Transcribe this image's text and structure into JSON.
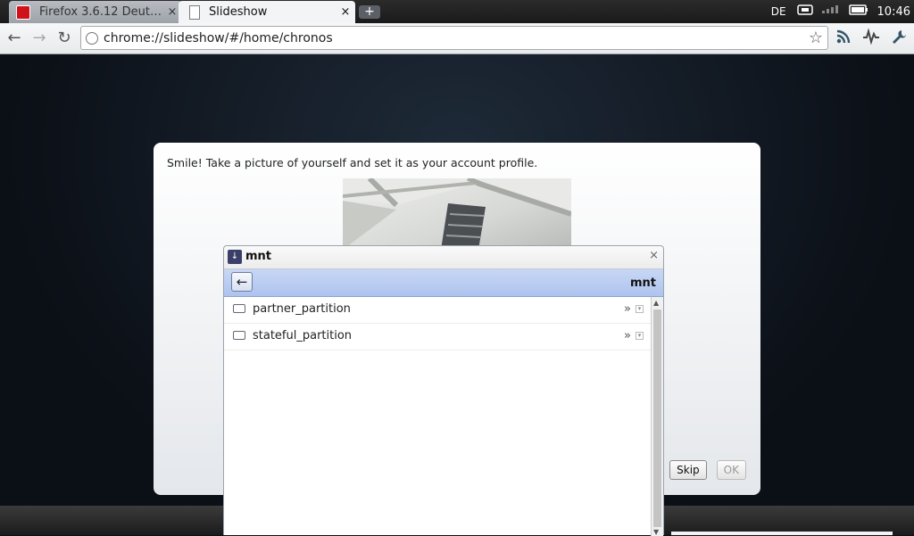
{
  "tabs": [
    {
      "title": "Firefox 3.6.12 Deutsch -...",
      "close": "×"
    },
    {
      "title": "Slideshow",
      "close": "×"
    }
  ],
  "new_tab": "+",
  "status": {
    "language": "DE",
    "clock": "10:46"
  },
  "omnibox": {
    "url": "chrome://slideshow/#/home/chronos"
  },
  "oobe": {
    "message": "Smile! Take a picture of yourself and set it as your account profile.",
    "skip_label": "Skip",
    "ok_label": "OK"
  },
  "dialog": {
    "title": "mnt",
    "close": "×",
    "current_path": "mnt",
    "items": [
      {
        "name": "partner_partition",
        "more": "»"
      },
      {
        "name": "stateful_partition",
        "more": "»"
      }
    ]
  },
  "colors": {
    "nav_bar": "#b8cbf1",
    "accent_red": "#d0121b"
  }
}
